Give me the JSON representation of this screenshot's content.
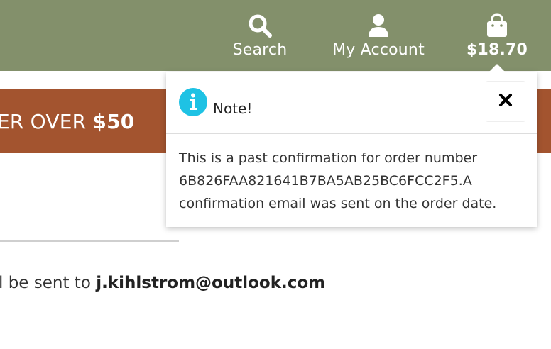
{
  "header": {
    "search_label": "Search",
    "account_label": "My Account",
    "cart_total": "$18.70",
    "icons": {
      "search": "search-icon",
      "account": "user-icon",
      "cart": "shopping-bag-icon"
    },
    "background": "#83906b"
  },
  "promo": {
    "text": "ER OVER ",
    "amount": "$50",
    "background": "#a3542f"
  },
  "main": {
    "email_prefix": "l be sent to ",
    "email": "j.kihlstrom@outlook.com"
  },
  "popover": {
    "title": "Note!",
    "body_lines": [
      "This is a past confirmation for order number",
      "6B826FAA821641B7BA5AB25BC6FCC2F5.A",
      "confirmation email was sent on the order date."
    ],
    "icons": {
      "info": "info-icon",
      "close": "close-icon"
    },
    "accent": "#1ec2e4"
  }
}
